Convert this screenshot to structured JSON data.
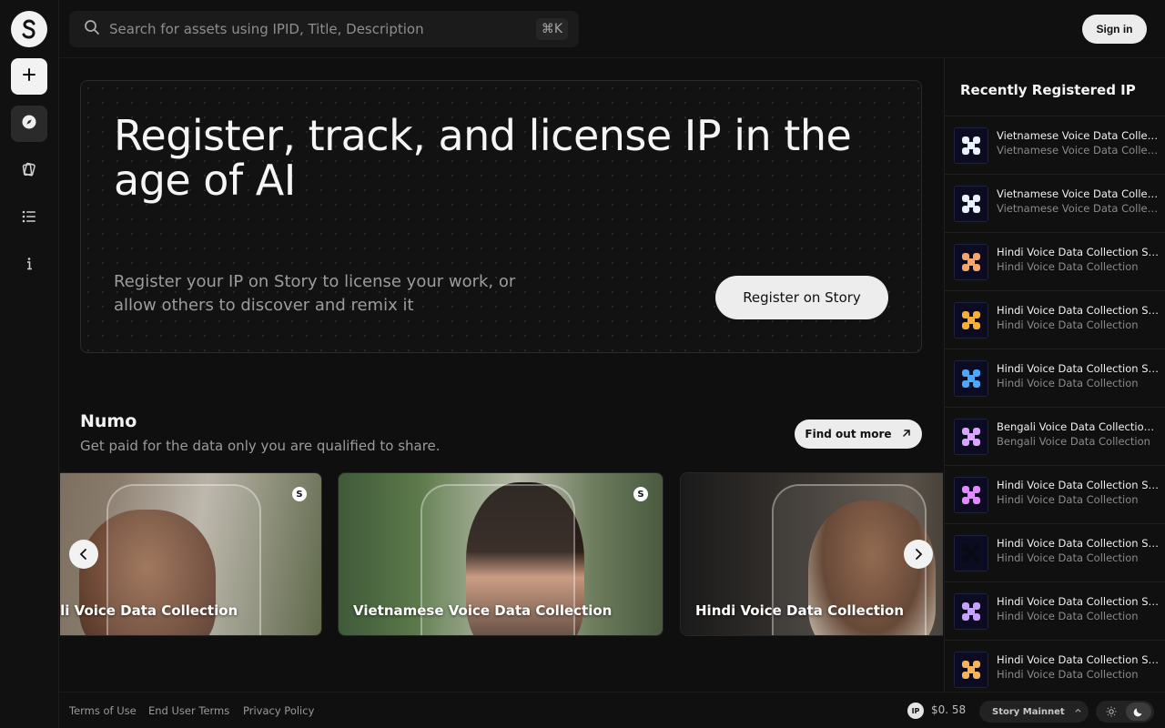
{
  "topbar": {
    "search_placeholder": "Search for assets using IPID, Title, Description",
    "shortcut": "⌘K",
    "signin_label": "Sign in"
  },
  "sidebar": {
    "logo": "S",
    "items": [
      {
        "name": "create",
        "icon": "plus-icon"
      },
      {
        "name": "explore",
        "icon": "compass-icon",
        "active": true
      },
      {
        "name": "licenses",
        "icon": "cards-icon"
      },
      {
        "name": "list",
        "icon": "list-icon"
      },
      {
        "name": "about",
        "icon": "info-icon"
      }
    ]
  },
  "hero": {
    "title": "Register, track, and license IP in the age of AI",
    "subtitle": "Register your IP on Story to license your work, or allow others to discover and remix it",
    "button_label": "Register on Story"
  },
  "numo": {
    "title": "Numo",
    "subtitle": "Get paid for the data only you are qualified to share.",
    "button_label": "Find out more",
    "cards": [
      {
        "title": "Bengali Voice Data Collection"
      },
      {
        "title": "Vietnamese Voice Data Collection"
      },
      {
        "title": "Hindi Voice Data Collection"
      }
    ]
  },
  "recent": {
    "title": "Recently Registered IP",
    "items": [
      {
        "title": "Vietnamese Voice Data Collection Submission",
        "subtitle": "Vietnamese Voice Data Collection",
        "color": "#e8f1ff"
      },
      {
        "title": "Vietnamese Voice Data Collection Submission",
        "subtitle": "Vietnamese Voice Data Collection",
        "color": "#e8f1ff"
      },
      {
        "title": "Hindi Voice Data Collection Submission",
        "subtitle": "Hindi Voice Data Collection",
        "color": "#f5a66a"
      },
      {
        "title": "Hindi Voice Data Collection Submission",
        "subtitle": "Hindi Voice Data Collection",
        "color": "#f7b035"
      },
      {
        "title": "Hindi Voice Data Collection Submission",
        "subtitle": "Hindi Voice Data Collection",
        "color": "#4aa8ff"
      },
      {
        "title": "Bengali Voice Data Collection Submission",
        "subtitle": "Bengali Voice Data Collection",
        "color": "#d9a6ff"
      },
      {
        "title": "Hindi Voice Data Collection Submission",
        "subtitle": "Hindi Voice Data Collection",
        "color": "#e08cff"
      },
      {
        "title": "Hindi Voice Data Collection Submission",
        "subtitle": "Hindi Voice Data Collection",
        "color": "#0a0a14"
      },
      {
        "title": "Hindi Voice Data Collection Submission",
        "subtitle": "Hindi Voice Data Collection",
        "color": "#c8a0ff"
      },
      {
        "title": "Hindi Voice Data Collection Submission",
        "subtitle": "Hindi Voice Data Collection",
        "color": "#f5b35a"
      }
    ]
  },
  "footer": {
    "links": [
      "Terms of Use",
      "End User Terms",
      "Privacy Policy"
    ],
    "token_icon": "IP",
    "price": "$0. 58",
    "network": "Story Mainnet"
  }
}
